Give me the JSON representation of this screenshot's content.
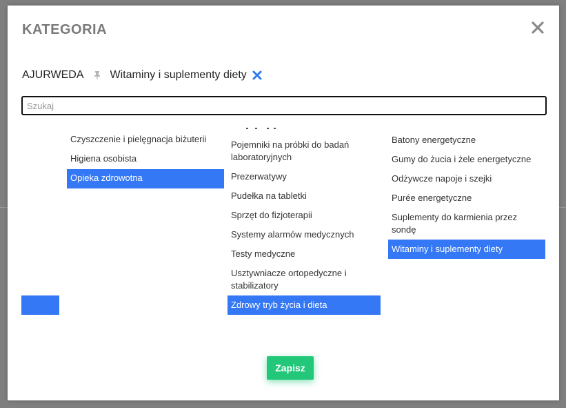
{
  "modal": {
    "title": "KATEGORIA"
  },
  "breadcrumb": {
    "items": [
      "AJURWEDA",
      "Witaminy i suplementy diety"
    ]
  },
  "search": {
    "placeholder": "Szukaj",
    "value": ""
  },
  "columns": [
    {
      "items": [
        {
          "label": "Czyszczenie i pielęgnacja biżuterii",
          "selected": false
        },
        {
          "label": "Higiena osobista",
          "selected": false
        },
        {
          "label": "Opieka zdrowotna",
          "selected": true
        }
      ]
    },
    {
      "items": [
        {
          "label": "Pojemniki na próbki do badań laboratoryjnych",
          "selected": false
        },
        {
          "label": "Prezerwatywy",
          "selected": false
        },
        {
          "label": "Pudełka na tabletki",
          "selected": false
        },
        {
          "label": "Sprzęt do fizjoterapii",
          "selected": false
        },
        {
          "label": "Systemy alarmów medycznych",
          "selected": false
        },
        {
          "label": "Testy medyczne",
          "selected": false
        },
        {
          "label": "Usztywniacze ortopedyczne i stabilizatory",
          "selected": false
        },
        {
          "label": "Zdrowy tryb życia i dieta",
          "selected": true
        }
      ]
    },
    {
      "items": [
        {
          "label": "Batony energetyczne",
          "selected": false
        },
        {
          "label": "Gumy do żucia i żele energetyczne",
          "selected": false
        },
        {
          "label": "Odżywcze napoje i szejki",
          "selected": false
        },
        {
          "label": "Purée energetyczne",
          "selected": false
        },
        {
          "label": "Suplementy do karmienia przez sondę",
          "selected": false
        },
        {
          "label": "Witaminy i suplementy diety",
          "selected": true
        }
      ]
    }
  ],
  "actions": {
    "save_label": "Zapisz"
  },
  "colors": {
    "selected_bg": "#3478f6",
    "save_bg": "#22c77a",
    "title": "#7a7a7a"
  },
  "icons": {
    "close": "close-icon",
    "separator": "pin-icon",
    "remove": "remove-icon"
  }
}
